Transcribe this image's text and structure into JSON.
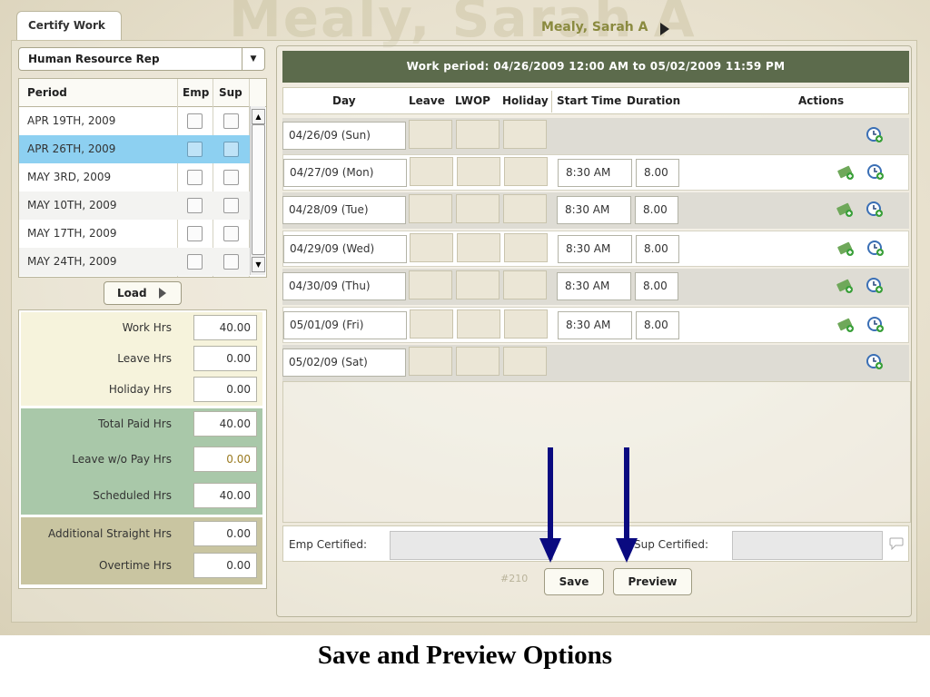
{
  "tab_label": "Certify Work",
  "watermark_text": "Mealy, Sarah A",
  "user_name": "Mealy, Sarah A",
  "role_select": "Human Resource Rep",
  "period_table": {
    "headers": {
      "period": "Period",
      "emp": "Emp",
      "sup": "Sup"
    },
    "rows": [
      {
        "label": "APR 19TH, 2009",
        "selected": false
      },
      {
        "label": "APR 26TH, 2009",
        "selected": true
      },
      {
        "label": "MAY 3RD, 2009",
        "selected": false
      },
      {
        "label": "MAY 10TH, 2009",
        "selected": false
      },
      {
        "label": "MAY 17TH, 2009",
        "selected": false
      },
      {
        "label": "MAY 24TH, 2009",
        "selected": false
      }
    ]
  },
  "load_button": "Load",
  "hours": {
    "work_label": "Work Hrs",
    "work_value": "40.00",
    "leave_label": "Leave Hrs",
    "leave_value": "0.00",
    "holiday_label": "Holiday Hrs",
    "holiday_value": "0.00",
    "total_paid_label": "Total Paid Hrs",
    "total_paid_value": "40.00",
    "lwop_label": "Leave w/o Pay Hrs",
    "lwop_value": "0.00",
    "scheduled_label": "Scheduled Hrs",
    "scheduled_value": "40.00",
    "additional_label": "Additional Straight Hrs",
    "additional_value": "0.00",
    "overtime_label": "Overtime Hrs",
    "overtime_value": "0.00"
  },
  "work_period": "Work period:   04/26/2009 12:00 AM  to  05/02/2009 11:59 PM",
  "columns": {
    "day": "Day",
    "leave": "Leave",
    "lwop": "LWOP",
    "holiday": "Holiday",
    "start_time": "Start Time",
    "duration": "Duration",
    "actions": "Actions"
  },
  "days": [
    {
      "day": "04/26/09 (Sun)",
      "start": "",
      "duration": ""
    },
    {
      "day": "04/27/09 (Mon)",
      "start": "8:30 AM",
      "duration": "8.00"
    },
    {
      "day": "04/28/09 (Tue)",
      "start": "8:30 AM",
      "duration": "8.00"
    },
    {
      "day": "04/29/09 (Wed)",
      "start": "8:30 AM",
      "duration": "8.00"
    },
    {
      "day": "04/30/09 (Thu)",
      "start": "8:30 AM",
      "duration": "8.00"
    },
    {
      "day": "05/01/09 (Fri)",
      "start": "8:30 AM",
      "duration": "8.00"
    },
    {
      "day": "05/02/09 (Sat)",
      "start": "",
      "duration": ""
    }
  ],
  "emp_certified_label": "Emp Certified:",
  "sup_certified_label": "Sup Certified:",
  "code_label": "#210",
  "save_button": "Save",
  "preview_button": "Preview",
  "caption": "Save and Preview Options",
  "colors": {
    "header_bar": "#5c6b4c",
    "selected_row": "#8dd0f1",
    "arrow": "#0a0a80",
    "totals_section": "#a9c8a9"
  },
  "icons": [
    "dropdown-arrow-icon",
    "play-icon",
    "money-add-icon",
    "clock-add-icon",
    "comment-icon",
    "down-arrow-icon"
  ]
}
